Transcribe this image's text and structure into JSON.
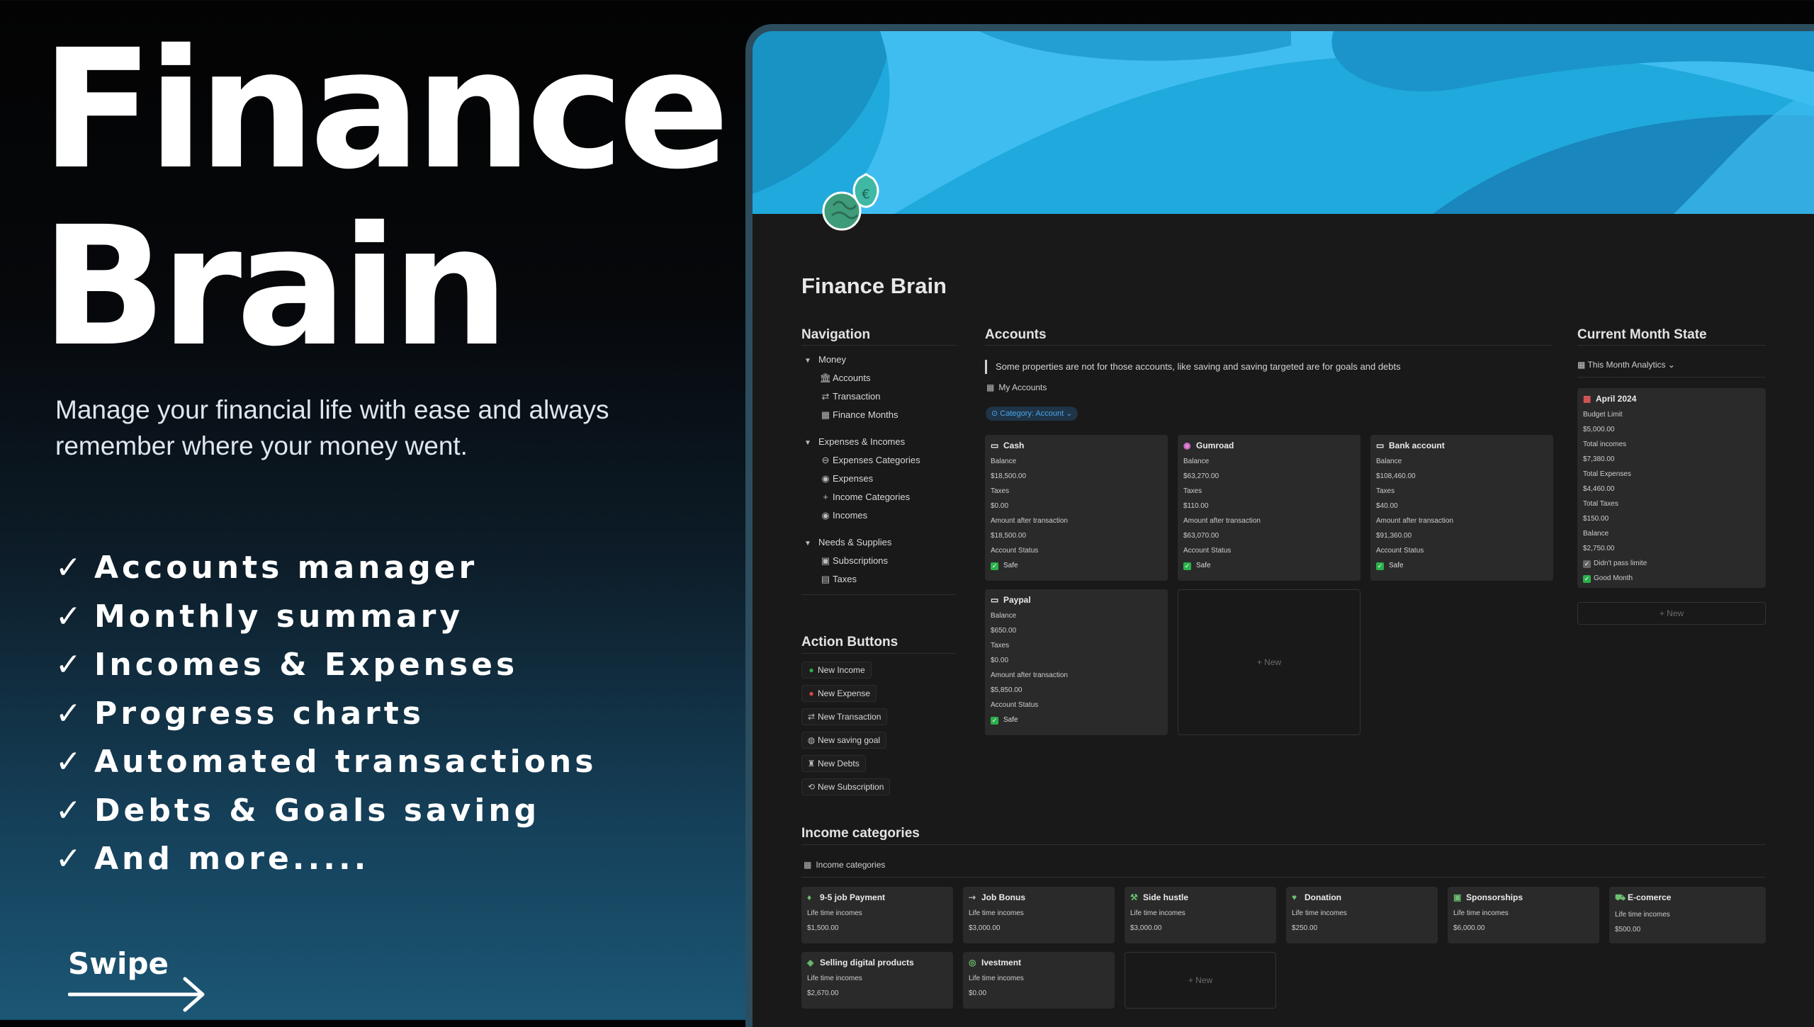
{
  "hero": {
    "title_line1": "Finance",
    "title_line2": "Brain",
    "tagline_line1": "Manage your financial life with ease and always",
    "tagline_line2": "remember where your money went.",
    "check_mark": "✓",
    "features": [
      "Accounts manager",
      "Monthly summary",
      "Incomes & Expenses",
      "Progress charts",
      "Automated transactions",
      "Debts & Goals saving",
      "And more....."
    ],
    "swipe_label": "Swipe"
  },
  "app": {
    "page_title": "Finance Brain",
    "navigation": {
      "heading": "Navigation",
      "groups": [
        {
          "label": "Money",
          "items": [
            {
              "label": "Accounts",
              "icon": "bank-icon"
            },
            {
              "label": "Transaction",
              "icon": "transfer-icon"
            },
            {
              "label": "Finance Months",
              "icon": "calendar-icon"
            }
          ]
        },
        {
          "label": "Expenses & Incomes",
          "items": [
            {
              "label": "Expenses Categories",
              "icon": "minus-circle-icon"
            },
            {
              "label": "Expenses",
              "icon": "coins-icon"
            },
            {
              "label": "Income Categories",
              "icon": "plus-icon"
            },
            {
              "label": "Incomes",
              "icon": "coins-icon"
            }
          ]
        },
        {
          "label": "Needs & Supplies",
          "items": [
            {
              "label": "Subscriptions",
              "icon": "ticket-icon"
            },
            {
              "label": "Taxes",
              "icon": "building-icon"
            }
          ]
        }
      ]
    },
    "action_buttons": {
      "heading": "Action Buttons",
      "buttons": [
        {
          "label": "New Income",
          "icon": "income-icon"
        },
        {
          "label": "New Expense",
          "icon": "expense-icon"
        },
        {
          "label": "New Transaction",
          "icon": "transfer-icon"
        },
        {
          "label": "New saving goal",
          "icon": "piggy-bank-icon"
        },
        {
          "label": "New Debts",
          "icon": "debt-icon"
        },
        {
          "label": "New Subscription",
          "icon": "subscription-icon"
        }
      ]
    },
    "accounts": {
      "heading": "Accounts",
      "callout": "Some properties are not for those accounts, like saving and saving targeted are for goals and debts",
      "db_label": "My Accounts",
      "filter": "Category: Account",
      "labels": {
        "balance": "Balance",
        "taxes": "Taxes",
        "after": "Amount after transaction",
        "status": "Account Status"
      },
      "cards": [
        {
          "name": "Cash",
          "icon": "cash-icon",
          "balance": "$18,500.00",
          "taxes": "$0.00",
          "after": "$18,500.00",
          "status": "Safe"
        },
        {
          "name": "Gumroad",
          "icon": "gumroad-icon",
          "balance": "$63,270.00",
          "taxes": "$110.00",
          "after": "$63,070.00",
          "status": "Safe"
        },
        {
          "name": "Bank account",
          "icon": "card-icon",
          "balance": "$108,460.00",
          "taxes": "$40.00",
          "after": "$91,360.00",
          "status": "Safe"
        },
        {
          "name": "Paypal",
          "icon": "card-icon",
          "balance": "$650.00",
          "taxes": "$0.00",
          "after": "$5,850.00",
          "status": "Safe"
        }
      ],
      "new_label": "+ New"
    },
    "month_state": {
      "heading": "Current Month State",
      "view_label": "This Month Analytics",
      "card": {
        "title": "April 2024",
        "rows": [
          {
            "label": "Budget Limit",
            "value": "$5,000.00"
          },
          {
            "label": "Total incomes",
            "value": "$7,380.00"
          },
          {
            "label": "Total Expenses",
            "value": "$4,460.00"
          },
          {
            "label": "Total Taxes",
            "value": "$150.00"
          },
          {
            "label": "Balance",
            "value": "$2,750.00"
          }
        ],
        "flags": [
          "Didn't pass limite",
          "Good Month"
        ]
      },
      "new_label": "+ New"
    },
    "income_categories": {
      "heading": "Income categories",
      "db_label": "Income categories",
      "field_label": "Life time incomes",
      "cards": [
        {
          "name": "9-5 job Payment",
          "value": "$1,500.00",
          "icon": "money-bag-icon"
        },
        {
          "name": "Job Bonus",
          "value": "$3,000.00",
          "icon": "bonus-icon"
        },
        {
          "name": "Side hustle",
          "value": "$3,000.00",
          "icon": "hammer-icon"
        },
        {
          "name": "Donation",
          "value": "$250.00",
          "icon": "donation-icon"
        },
        {
          "name": "Sponsorships",
          "value": "$6,000.00",
          "icon": "sponsor-icon"
        },
        {
          "name": "E-comerce",
          "value": "$500.00",
          "icon": "cart-icon"
        },
        {
          "name": "Selling digital products",
          "value": "$2,670.00",
          "icon": "tag-icon"
        },
        {
          "name": "Ivestment",
          "value": "$0.00",
          "icon": "investment-icon"
        }
      ],
      "new_label": "+ New"
    }
  },
  "colors": {
    "accent_blue": "#29b6f6",
    "safe_green": "#2bb04c",
    "panel": "#191919"
  }
}
